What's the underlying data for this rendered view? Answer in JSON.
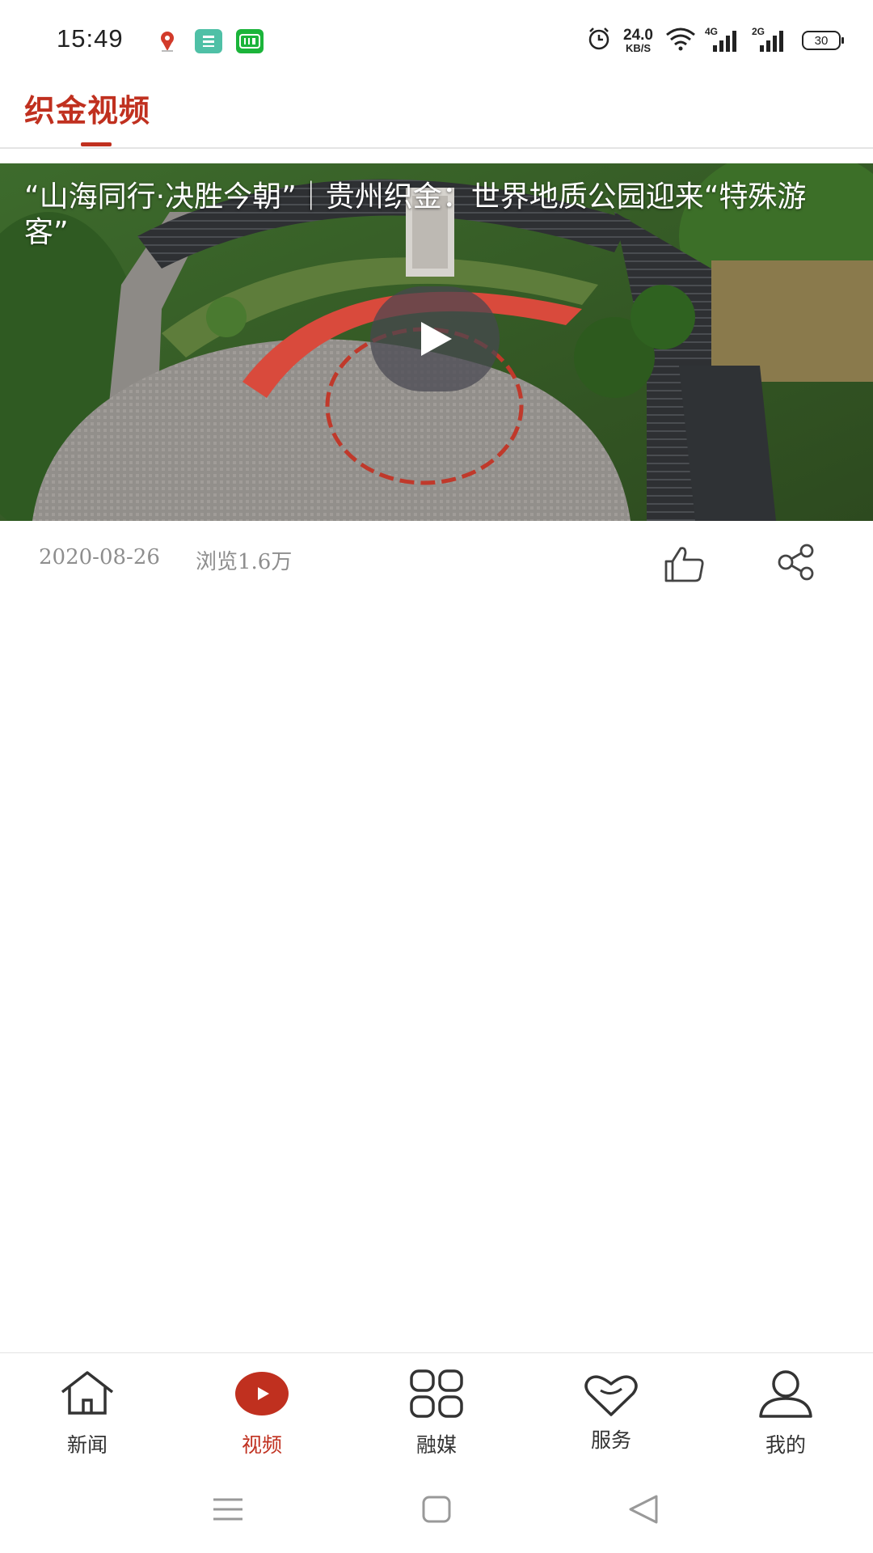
{
  "status_bar": {
    "time": "15:49",
    "net_speed_value": "24.0",
    "net_speed_unit": "KB/S",
    "signal_1_label": "4G",
    "signal_2_label": "2G",
    "battery": "30",
    "icons": [
      "map-pin-icon",
      "app-icon",
      "iqiyi-icon",
      "alarm-icon",
      "wifi-icon"
    ]
  },
  "header": {
    "title": "织金视频",
    "accent_color": "#c0301f"
  },
  "video": {
    "title": "“山海同行·决胜今朝”｜贵州织金：世界地质公园迎来“特殊游客”",
    "date": "2020-08-26",
    "views": "浏览1.6万"
  },
  "tab_bar": {
    "items": [
      {
        "label": "新闻",
        "icon": "home-icon",
        "active": false
      },
      {
        "label": "视频",
        "icon": "play-circle-icon",
        "active": true
      },
      {
        "label": "融媒",
        "icon": "grid-icon",
        "active": false
      },
      {
        "label": "服务",
        "icon": "heart-icon",
        "active": false
      },
      {
        "label": "我的",
        "icon": "user-icon",
        "active": false
      }
    ]
  },
  "nav_bar": {
    "icons": [
      "menu-icon",
      "home-square-icon",
      "back-triangle-icon"
    ]
  }
}
